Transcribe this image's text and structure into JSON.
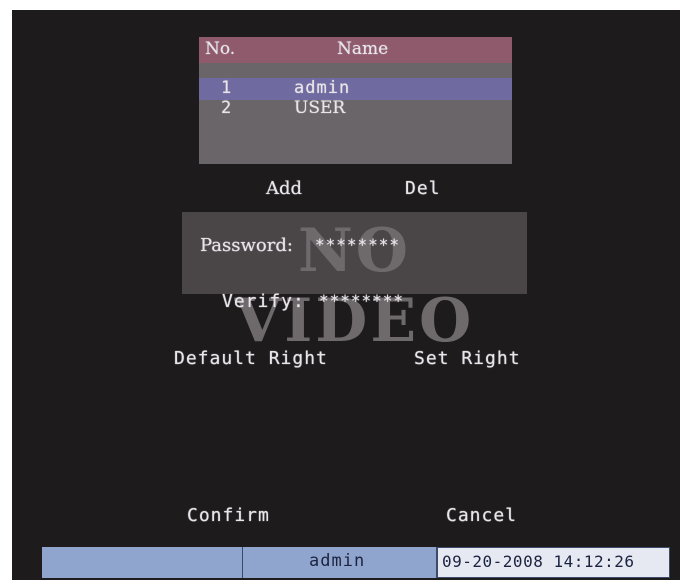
{
  "user_table": {
    "headers": {
      "no": "No.",
      "name": "Name"
    },
    "rows": [
      {
        "no": "1",
        "name": "admin"
      },
      {
        "no": "2",
        "name": "USER"
      }
    ]
  },
  "buttons": {
    "add": "Add",
    "del": "Del",
    "default_right": "Default Right",
    "set_right": "Set Right",
    "confirm": "Confirm",
    "cancel": "Cancel"
  },
  "fields": {
    "password_label": "Password:",
    "password_value": "********",
    "verify_label": "Verify:",
    "verify_value": "********"
  },
  "overlay": {
    "no_video": "NO VIDEO"
  },
  "status_bar": {
    "user": "admin",
    "datetime": "09-20-2008 14:12:26"
  }
}
